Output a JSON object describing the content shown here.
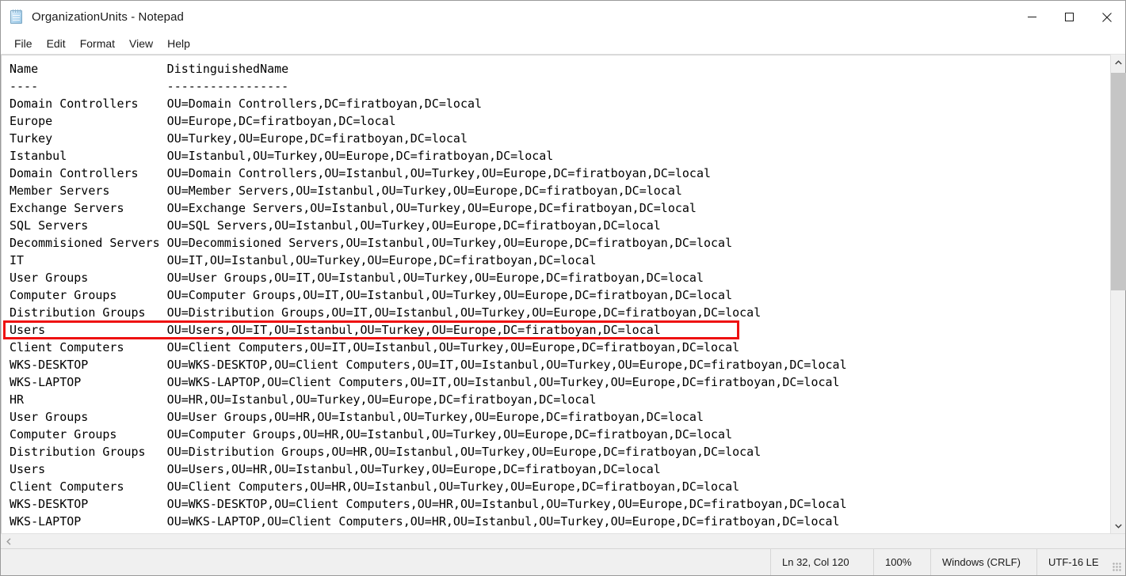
{
  "window": {
    "title": "OrganizationUnits - Notepad",
    "app_icon": "notepad-icon",
    "controls": {
      "minimize": "minimize-icon",
      "maximize": "maximize-icon",
      "close": "close-icon"
    }
  },
  "menubar": {
    "items": [
      {
        "label": "File"
      },
      {
        "label": "Edit"
      },
      {
        "label": "Format"
      },
      {
        "label": "View"
      },
      {
        "label": "Help"
      }
    ]
  },
  "colors": {
    "highlight_box": "#ee1111",
    "text": "#000000",
    "background": "#ffffff",
    "statusbar": "#f0f0f0",
    "scrollbar_thumb": "#c5c5c5"
  },
  "document": {
    "columns": [
      "Name",
      "DistinguishedName"
    ],
    "header_line": "Name                  DistinguishedName",
    "separator_line": "----                  -----------------",
    "highlighted_line_index": 15,
    "lines": [
      "Name                  DistinguishedName",
      "----                  -----------------",
      "Domain Controllers    OU=Domain Controllers,DC=firatboyan,DC=local",
      "Europe                OU=Europe,DC=firatboyan,DC=local",
      "Turkey                OU=Turkey,OU=Europe,DC=firatboyan,DC=local",
      "Istanbul              OU=Istanbul,OU=Turkey,OU=Europe,DC=firatboyan,DC=local",
      "Domain Controllers    OU=Domain Controllers,OU=Istanbul,OU=Turkey,OU=Europe,DC=firatboyan,DC=local",
      "Member Servers        OU=Member Servers,OU=Istanbul,OU=Turkey,OU=Europe,DC=firatboyan,DC=local",
      "Exchange Servers      OU=Exchange Servers,OU=Istanbul,OU=Turkey,OU=Europe,DC=firatboyan,DC=local",
      "SQL Servers           OU=SQL Servers,OU=Istanbul,OU=Turkey,OU=Europe,DC=firatboyan,DC=local",
      "Decommisioned Servers OU=Decommisioned Servers,OU=Istanbul,OU=Turkey,OU=Europe,DC=firatboyan,DC=local",
      "IT                    OU=IT,OU=Istanbul,OU=Turkey,OU=Europe,DC=firatboyan,DC=local",
      "User Groups           OU=User Groups,OU=IT,OU=Istanbul,OU=Turkey,OU=Europe,DC=firatboyan,DC=local",
      "Computer Groups       OU=Computer Groups,OU=IT,OU=Istanbul,OU=Turkey,OU=Europe,DC=firatboyan,DC=local",
      "Distribution Groups   OU=Distribution Groups,OU=IT,OU=Istanbul,OU=Turkey,OU=Europe,DC=firatboyan,DC=local",
      "Users                 OU=Users,OU=IT,OU=Istanbul,OU=Turkey,OU=Europe,DC=firatboyan,DC=local",
      "Client Computers      OU=Client Computers,OU=IT,OU=Istanbul,OU=Turkey,OU=Europe,DC=firatboyan,DC=local",
      "WKS-DESKTOP           OU=WKS-DESKTOP,OU=Client Computers,OU=IT,OU=Istanbul,OU=Turkey,OU=Europe,DC=firatboyan,DC=local",
      "WKS-LAPTOP            OU=WKS-LAPTOP,OU=Client Computers,OU=IT,OU=Istanbul,OU=Turkey,OU=Europe,DC=firatboyan,DC=local",
      "HR                    OU=HR,OU=Istanbul,OU=Turkey,OU=Europe,DC=firatboyan,DC=local",
      "User Groups           OU=User Groups,OU=HR,OU=Istanbul,OU=Turkey,OU=Europe,DC=firatboyan,DC=local",
      "Computer Groups       OU=Computer Groups,OU=HR,OU=Istanbul,OU=Turkey,OU=Europe,DC=firatboyan,DC=local",
      "Distribution Groups   OU=Distribution Groups,OU=HR,OU=Istanbul,OU=Turkey,OU=Europe,DC=firatboyan,DC=local",
      "Users                 OU=Users,OU=HR,OU=Istanbul,OU=Turkey,OU=Europe,DC=firatboyan,DC=local",
      "Client Computers      OU=Client Computers,OU=HR,OU=Istanbul,OU=Turkey,OU=Europe,DC=firatboyan,DC=local",
      "WKS-DESKTOP           OU=WKS-DESKTOP,OU=Client Computers,OU=HR,OU=Istanbul,OU=Turkey,OU=Europe,DC=firatboyan,DC=local",
      "WKS-LAPTOP            OU=WKS-LAPTOP,OU=Client Computers,OU=HR,OU=Istanbul,OU=Turkey,OU=Europe,DC=firatboyan,DC=local"
    ]
  },
  "scrollbars": {
    "vertical": {
      "up_icon": "chevron-up-icon",
      "down_icon": "chevron-down-icon"
    },
    "horizontal": {
      "left_icon": "chevron-left-icon"
    }
  },
  "statusbar": {
    "position": "Ln 32, Col 120",
    "zoom": "100%",
    "line_ending": "Windows (CRLF)",
    "encoding": "UTF-16 LE",
    "grip": "resize-grip-icon"
  }
}
